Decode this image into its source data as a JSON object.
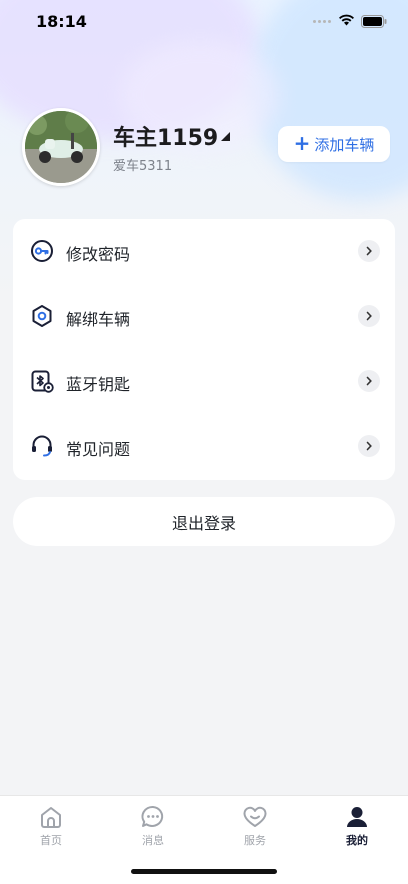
{
  "status_bar": {
    "time": "18:14"
  },
  "profile": {
    "name": "车主1159",
    "vehicle": "爱车5311",
    "add_vehicle_label": "添加车辆"
  },
  "menu": {
    "items": [
      {
        "label": "修改密码",
        "icon": "key-icon"
      },
      {
        "label": "解绑车辆",
        "icon": "unbind-icon"
      },
      {
        "label": "蓝牙钥匙",
        "icon": "bluetooth-key-icon"
      },
      {
        "label": "常见问题",
        "icon": "headset-icon"
      }
    ]
  },
  "logout_label": "退出登录",
  "tabbar": {
    "items": [
      {
        "label": "首页",
        "icon": "home-icon"
      },
      {
        "label": "消息",
        "icon": "message-icon"
      },
      {
        "label": "服务",
        "icon": "heart-icon"
      },
      {
        "label": "我的",
        "icon": "user-icon",
        "active": true
      }
    ]
  },
  "colors": {
    "accent": "#2f6fe4",
    "icon_dark": "#1a1f36",
    "icon_blue": "#2f6fe4",
    "inactive": "#a0a4ab"
  }
}
